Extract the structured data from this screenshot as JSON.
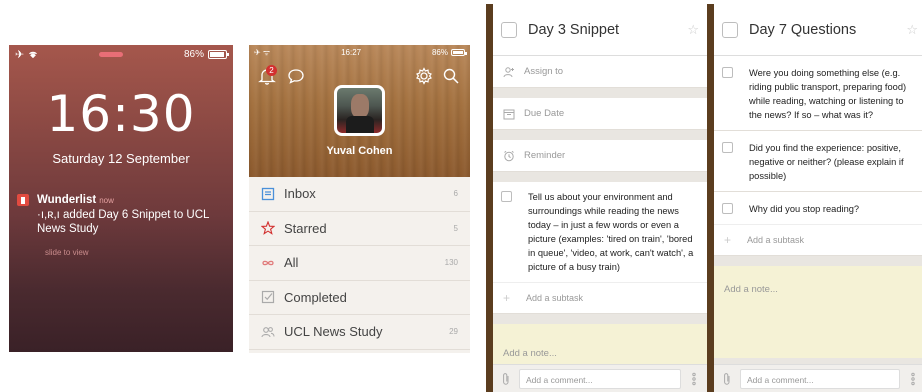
{
  "lock_screen": {
    "status": {
      "battery": "86%"
    },
    "time": "16:30",
    "date": "Saturday 12 September",
    "notification": {
      "app": "Wunderlist",
      "when": "now",
      "message": "·ı,ʀ,ı added Day 6 Snippet to UCL News Study",
      "action": "slide to view"
    }
  },
  "menu": {
    "status": {
      "time": "16:27",
      "battery": "86%"
    },
    "notification_count": "2",
    "user_name": "Yuval Cohen",
    "items": [
      {
        "label": "Inbox",
        "count": "6",
        "icon": "inbox-icon"
      },
      {
        "label": "Starred",
        "count": "5",
        "icon": "star-icon"
      },
      {
        "label": "All",
        "count": "130",
        "icon": "infinity-icon"
      },
      {
        "label": "Completed",
        "count": "",
        "icon": "checkbox-icon"
      },
      {
        "label": "UCL News Study",
        "count": "29",
        "icon": "group-icon"
      }
    ],
    "colors": {
      "accent_red": "#d2302f",
      "inbox_blue": "#4a90d9"
    }
  },
  "detail_a": {
    "title": "Day 3 Snippet",
    "assign": "Assign to",
    "due": "Due Date",
    "reminder": "Reminder",
    "subtask": "Tell us about your environment and surroundings while reading the news today – in just a few words or even a picture (examples: 'tired on train', 'bored in queue', 'video, at work, can't watch', a picture of a busy train)",
    "add_subtask": "Add a subtask",
    "note": "Add a note...",
    "comment_placeholder": "Add a comment..."
  },
  "detail_b": {
    "title": "Day 7 Questions",
    "subtasks": [
      "Were you doing something else (e.g. riding public transport, preparing food) while reading, watching or listening to the news? If so – what was it?",
      "Did you find the experience: positive, negative or neither? (please explain if possible)",
      "Why did you stop reading?"
    ],
    "add_subtask": "Add a subtask",
    "note": "Add a note...",
    "comment_placeholder": "Add a comment..."
  }
}
